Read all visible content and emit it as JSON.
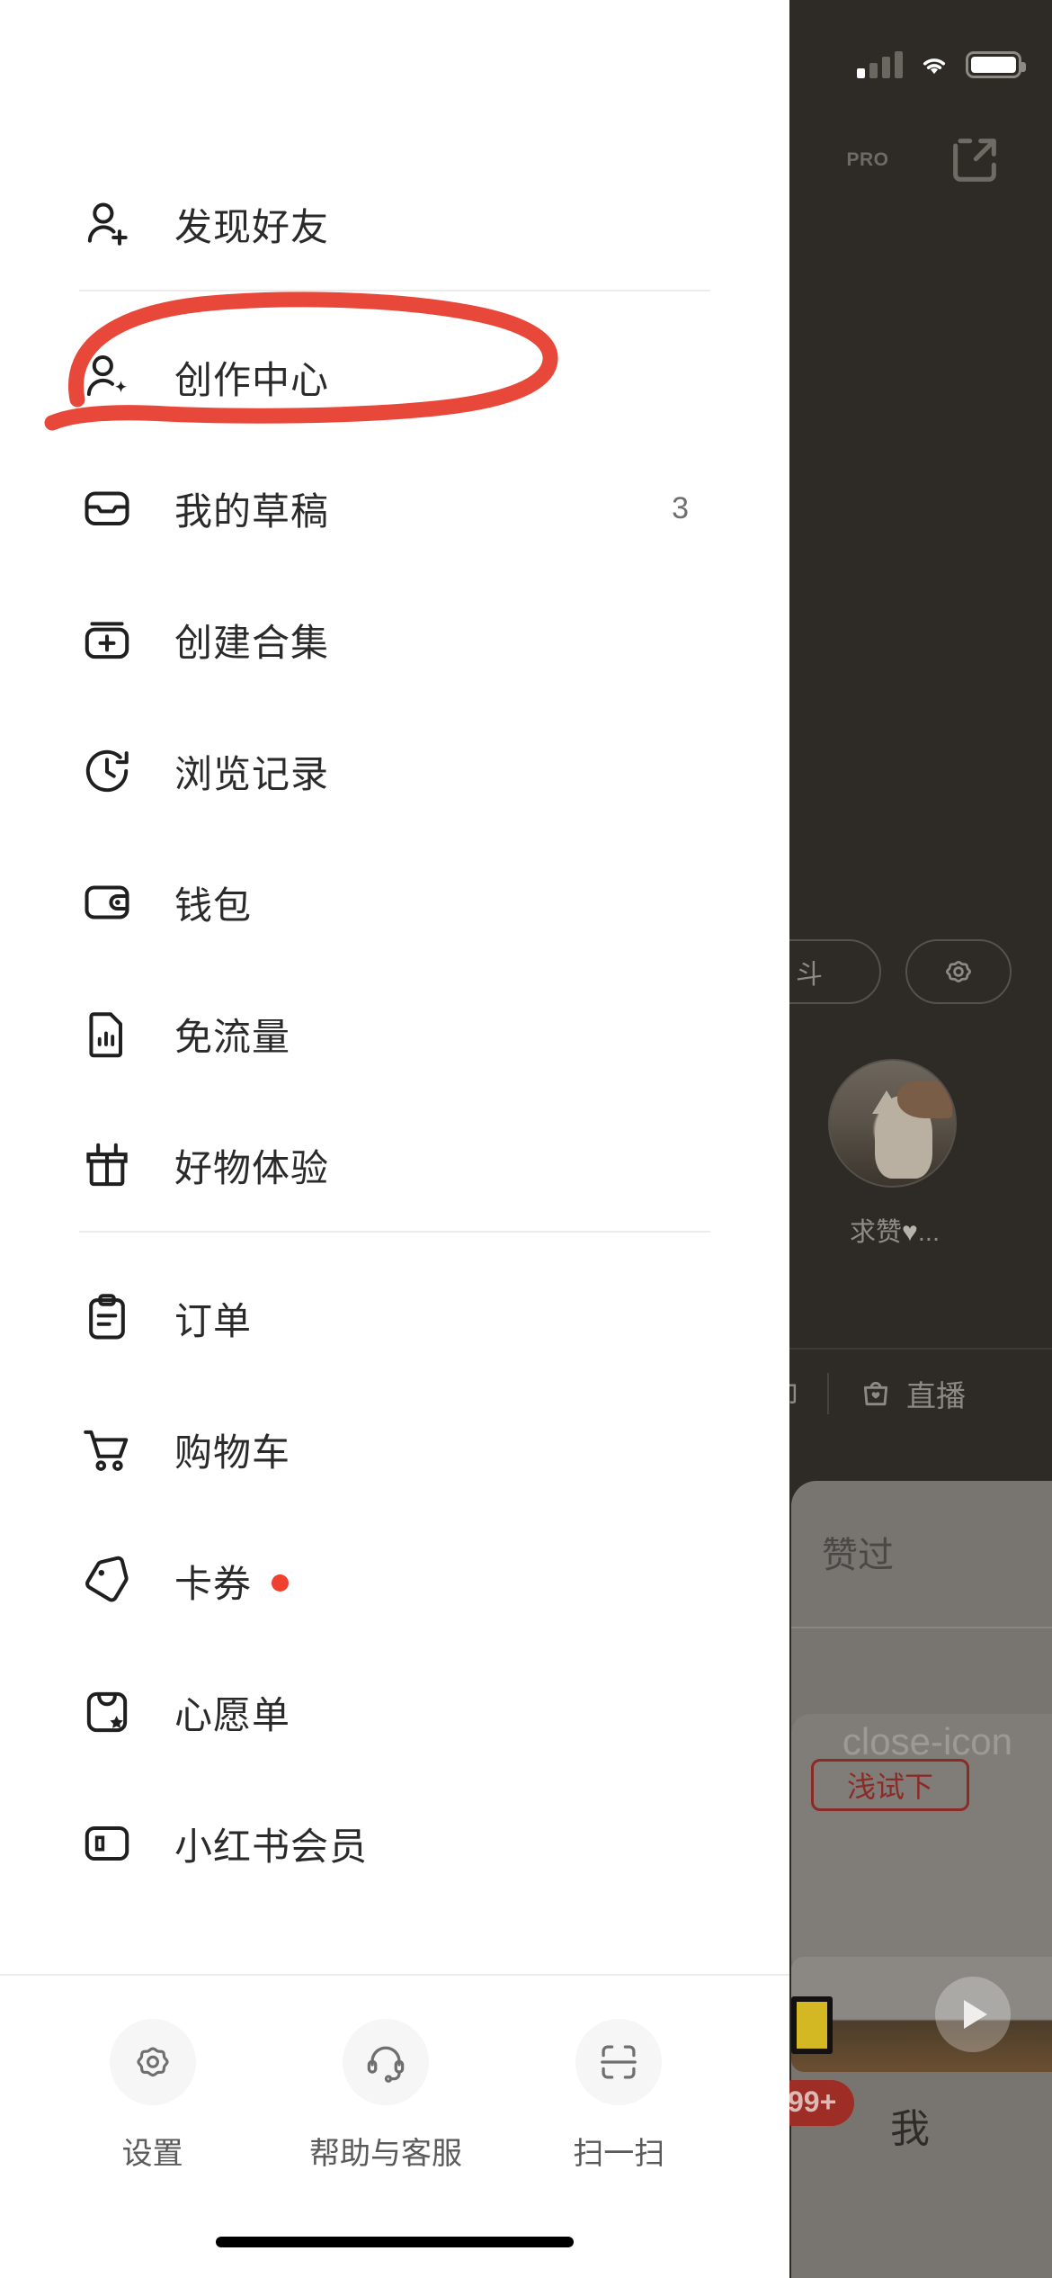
{
  "status_bar": {
    "signal_icon": "cellular-signal-icon",
    "wifi_icon": "wifi-icon",
    "battery_icon": "battery-icon"
  },
  "background": {
    "pro_badge": "PRO",
    "share_icon": "share-external-icon",
    "chip_partial_label": "斗",
    "settings_icon": "gear-icon",
    "avatar_caption": "求赞",
    "avatar_caption_suffix": "...",
    "heart_glyph": "♥",
    "live_partial_label": "卯",
    "live_label": "直播",
    "sheet_title": "赞过",
    "try_button_label": "浅试下",
    "close_icon": "close-icon",
    "play_icon": "play-icon",
    "badge_count": "99+",
    "tab_me_label": "我"
  },
  "drawer": {
    "groups": [
      {
        "items": [
          {
            "label": "发现好友",
            "icon": "user-add-icon",
            "count": "",
            "dot": false
          }
        ]
      },
      {
        "items": [
          {
            "label": "创作中心",
            "icon": "user-sparkle-icon",
            "count": "",
            "dot": false
          },
          {
            "label": "我的草稿",
            "icon": "drafts-inbox-icon",
            "count": "3",
            "dot": false
          },
          {
            "label": "创建合集",
            "icon": "collection-plus-icon",
            "count": "",
            "dot": false
          },
          {
            "label": "浏览记录",
            "icon": "history-clock-icon",
            "count": "",
            "dot": false
          },
          {
            "label": "钱包",
            "icon": "wallet-icon",
            "count": "",
            "dot": false
          },
          {
            "label": "免流量",
            "icon": "sim-data-icon",
            "count": "",
            "dot": false
          },
          {
            "label": "好物体验",
            "icon": "gift-icon",
            "count": "",
            "dot": false
          }
        ]
      },
      {
        "items": [
          {
            "label": "订单",
            "icon": "clipboard-order-icon",
            "count": "",
            "dot": false
          },
          {
            "label": "购物车",
            "icon": "shopping-cart-icon",
            "count": "",
            "dot": true
          },
          {
            "label": "卡券",
            "icon": "coupon-tag-icon",
            "count": "",
            "dot": true
          },
          {
            "label": "心愿单",
            "icon": "wishlist-bag-star-icon",
            "count": "",
            "dot": false
          },
          {
            "label": "小红书会员",
            "icon": "membership-card-icon",
            "count": "",
            "dot": false
          }
        ]
      }
    ],
    "footer": [
      {
        "label": "设置",
        "icon": "gear-icon"
      },
      {
        "label": "帮助与客服",
        "icon": "headset-support-icon"
      },
      {
        "label": "扫一扫",
        "icon": "scan-qr-icon"
      }
    ]
  },
  "annotation": {
    "shape": "hand-drawn-red-ellipse",
    "color": "#e8483a",
    "targets_label": "创作中心"
  }
}
